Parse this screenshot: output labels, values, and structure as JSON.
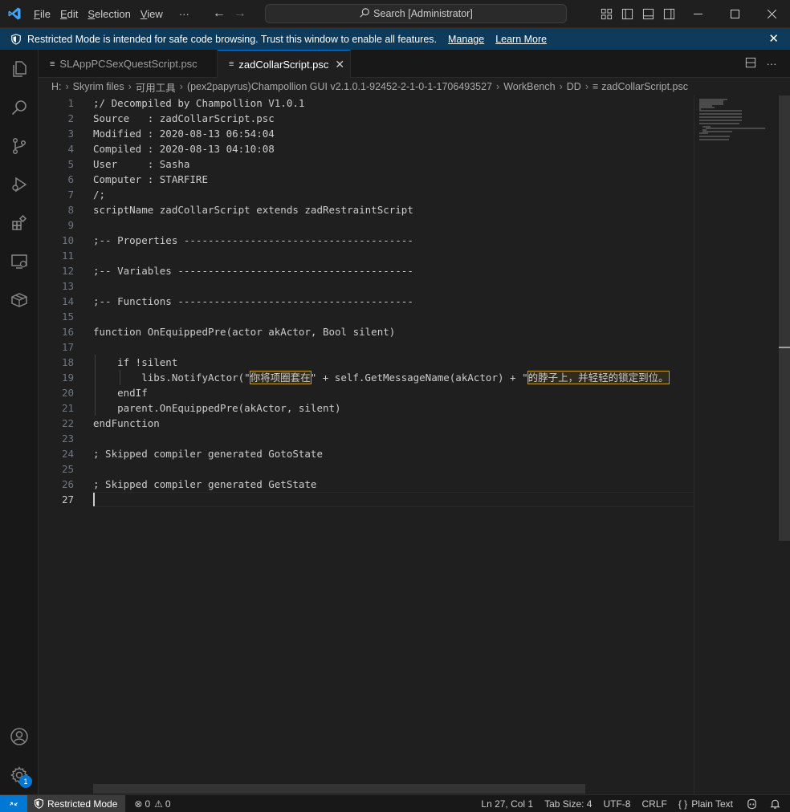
{
  "titlebar": {
    "menu": [
      {
        "first": "F",
        "rest": "ile"
      },
      {
        "first": "E",
        "rest": "dit"
      },
      {
        "first": "S",
        "rest": "election"
      },
      {
        "first": "V",
        "rest": "iew"
      }
    ],
    "more": "···",
    "search": "Search [Administrator]"
  },
  "banner": {
    "message": "Restricted Mode is intended for safe code browsing. Trust this window to enable all features.",
    "manage": "Manage",
    "learn_more": "Learn More"
  },
  "tabs": [
    {
      "label": "SLAppPCSexQuestScript.psc",
      "active": false
    },
    {
      "label": "zadCollarScript.psc",
      "active": true
    }
  ],
  "breadcrumb": [
    "H:",
    "Skyrim files",
    "可用工具",
    "(pex2papyrus)Champollion GUI v2.1.0.1-92452-2-1-0-1-1706493527",
    "WorkBench",
    "DD",
    "zadCollarScript.psc"
  ],
  "editor": {
    "current_line": 27,
    "lines": [
      ";/ Decompiled by Champollion V1.0.1",
      "Source   : zadCollarScript.psc",
      "Modified : 2020-08-13 06:54:04",
      "Compiled : 2020-08-13 04:10:08",
      "User     : Sasha",
      "Computer : STARFIRE",
      "/;",
      "scriptName zadCollarScript extends zadRestraintScript",
      "",
      ";-- Properties --------------------------------------",
      "",
      ";-- Variables ---------------------------------------",
      "",
      ";-- Functions ---------------------------------------",
      "",
      "function OnEquippedPre(actor akActor, Bool silent)",
      "",
      "    if !silent",
      "        libs.NotifyActor(\"你将项圈套在\" + self.GetMessageName(akActor) + \"的脖子上，并轻轻的锁定到位。",
      "    endIf",
      "    parent.OnEquippedPre(akActor, silent)",
      "endFunction",
      "",
      "; Skipped compiler generated GotoState",
      "",
      "; Skipped compiler generated GetState",
      ""
    ],
    "line19_parts": {
      "pre": "        libs.NotifyActor(\"",
      "hl1": "你将项圈套在",
      "mid": "\" + self.GetMessageName(akActor) + \"",
      "hl2": "的脖子上，并轻轻的锁定到位。"
    }
  },
  "status": {
    "restricted_mode": "Restricted Mode",
    "errors": "0",
    "warnings": "0",
    "position": "Ln 27, Col 1",
    "tab_size": "Tab Size: 4",
    "encoding": "UTF-8",
    "eol": "CRLF",
    "language": "Plain Text",
    "notification_badge": "1"
  }
}
